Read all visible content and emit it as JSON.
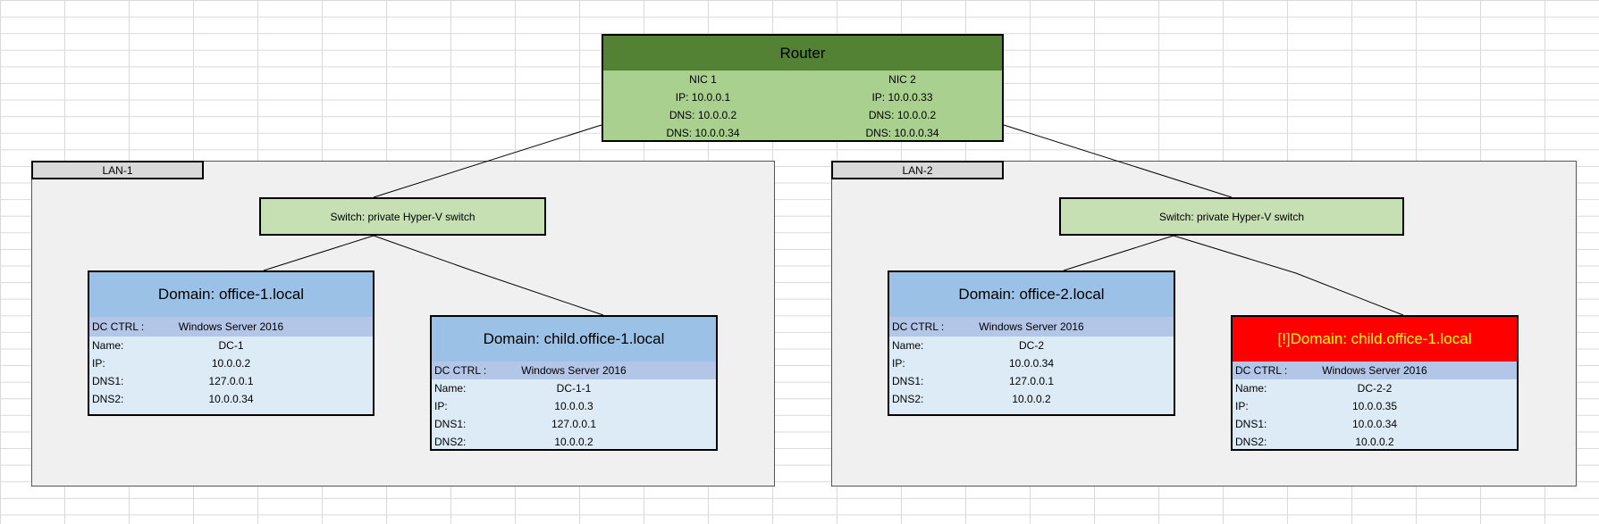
{
  "router": {
    "title": "Router",
    "nic1": {
      "name": "NIC 1",
      "ip": "IP: 10.0.0.1",
      "dns1": "DNS: 10.0.0.2",
      "dns2": "DNS: 10.0.0.34"
    },
    "nic2": {
      "name": "NIC 2",
      "ip": "IP: 10.0.0.33",
      "dns1": "DNS: 10.0.0.2",
      "dns2": "DNS: 10.0.0.34"
    }
  },
  "lan1": {
    "label": "LAN-1",
    "switch": "Switch: private Hyper-V switch",
    "dc_a": {
      "title": "Domain: office-1.local",
      "ctrl_key": "DC CTRL :",
      "ctrl_val": "Windows Server 2016",
      "name_key": "Name:",
      "name_val": "DC-1",
      "ip_key": "IP:",
      "ip_val": "10.0.0.2",
      "dns1_key": "DNS1:",
      "dns1_val": "127.0.0.1",
      "dns2_key": "DNS2:",
      "dns2_val": "10.0.0.34"
    },
    "dc_b": {
      "title": "Domain: child.office-1.local",
      "ctrl_key": "DC CTRL :",
      "ctrl_val": "Windows Server 2016",
      "name_key": "Name:",
      "name_val": "DC-1-1",
      "ip_key": "IP:",
      "ip_val": "10.0.0.3",
      "dns1_key": "DNS1:",
      "dns1_val": "127.0.0.1",
      "dns2_key": "DNS2:",
      "dns2_val": "10.0.0.2"
    }
  },
  "lan2": {
    "label": "LAN-2",
    "switch": "Switch: private Hyper-V switch",
    "dc_a": {
      "title": "Domain: office-2.local",
      "ctrl_key": "DC CTRL :",
      "ctrl_val": "Windows Server 2016",
      "name_key": "Name:",
      "name_val": "DC-2",
      "ip_key": "IP:",
      "ip_val": "10.0.0.34",
      "dns1_key": "DNS1:",
      "dns1_val": "127.0.0.1",
      "dns2_key": "DNS2:",
      "dns2_val": "10.0.0.2"
    },
    "dc_b": {
      "title": "[!]Domain: child.office-1.local",
      "ctrl_key": "DC CTRL :",
      "ctrl_val": "Windows Server 2016",
      "name_key": "Name:",
      "name_val": "DC-2-2",
      "ip_key": "IP:",
      "ip_val": "10.0.0.35",
      "dns1_key": "DNS1:",
      "dns1_val": "10.0.0.34",
      "dns2_key": "DNS2:",
      "dns2_val": "10.0.0.2"
    }
  },
  "colors": {
    "router_header": "#548235",
    "router_body": "#a9d08e",
    "switch": "#c6e0b4",
    "dc_header": "#9bc2e6",
    "dc_ctrl_row": "#b4c6e7",
    "dc_body": "#ddebf7",
    "warning_fill": "#ff0000",
    "warning_text": "#ffff00",
    "lan_fill": "#f0f0f0"
  }
}
